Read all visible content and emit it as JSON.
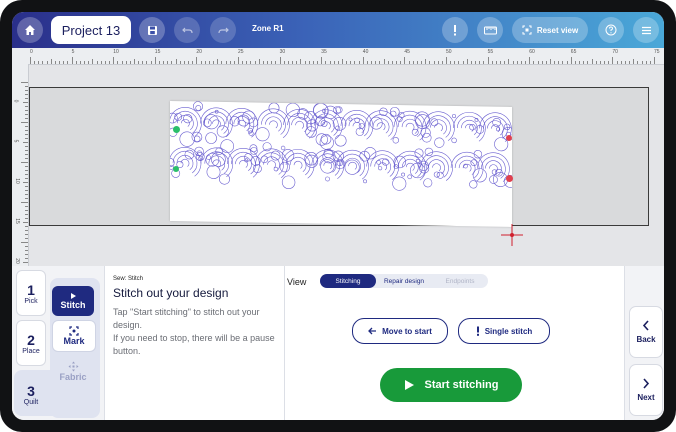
{
  "topbar": {
    "project_name": "Project 13",
    "zone_label": "Zone R1",
    "reset_view_label": "Reset view",
    "icons": [
      "home-icon",
      "save-icon",
      "undo-icon",
      "redo-icon",
      "alert-icon",
      "ruler-icon",
      "reset-view-icon",
      "help-icon",
      "menu-icon"
    ]
  },
  "ruler": {
    "top_ticks": [
      "0",
      "5",
      "10",
      "15",
      "20",
      "25",
      "30",
      "35",
      "40",
      "45",
      "50",
      "55",
      "60",
      "65",
      "70",
      "75"
    ],
    "left_ticks": [
      "0",
      "5",
      "10",
      "15",
      "20"
    ]
  },
  "steps": [
    {
      "num": "1",
      "label": "Pick"
    },
    {
      "num": "2",
      "label": "Place"
    },
    {
      "num": "3",
      "label": "Quilt"
    }
  ],
  "tools": {
    "stitch": "Stitch",
    "mark": "Mark",
    "fabric": "Fabric"
  },
  "info": {
    "breadcrumb": "Sew: Stitch",
    "title": "Stitch out your design",
    "description": "Tap \"Start stitching\" to stitch out your design.",
    "description2": "If you need to stop, there will be a pause button."
  },
  "view": {
    "label": "View",
    "options": [
      "Stitching",
      "Repair design",
      "Endpoints"
    ],
    "selected": "Stitching"
  },
  "actions": {
    "move_to_start": "Move to start",
    "single_stitch": "Single stitch",
    "start_stitching": "Start stitching"
  },
  "nav": {
    "back": "Back",
    "next": "Next"
  },
  "colors": {
    "accent_navy": "#1f2a80",
    "start_green": "#189a3a",
    "stitch_purple": "#6a5fd0",
    "start_dot_green": "#2bbf6a",
    "end_dot_red": "#e0404e"
  }
}
